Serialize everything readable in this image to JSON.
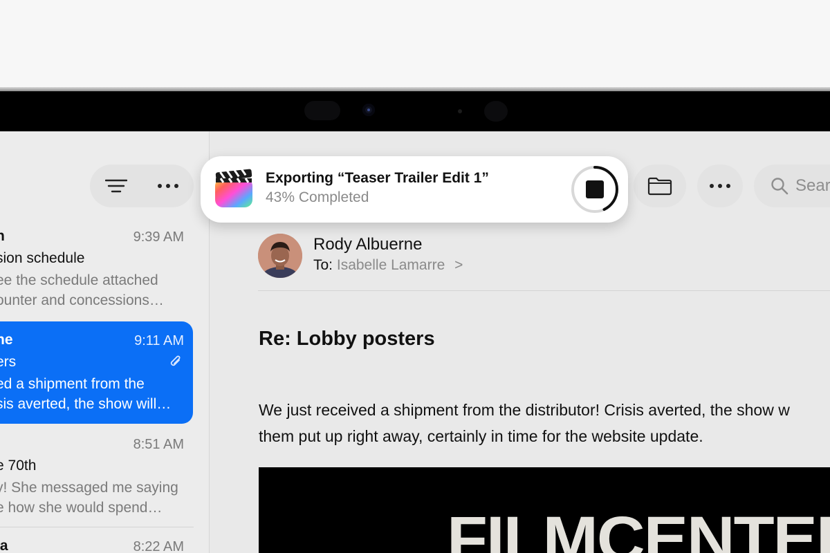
{
  "sidebar": {
    "toolbar": {
      "filter_icon": "filter-lines-icon",
      "more_icon": "ellipsis-icon"
    },
    "messages": [
      {
        "sender": "n",
        "time": "9:39 AM",
        "subject": "sion schedule",
        "preview_line_1": "ee the schedule attached",
        "preview_line_2": "ounter and concessions…",
        "selected": false
      },
      {
        "sender": "ne",
        "time": "9:11 AM",
        "subject": "ers",
        "preview_line_1": "ed a shipment from the",
        "preview_line_2": "sis averted, the show will…",
        "selected": true,
        "attachment_icon": "paperclip-icon"
      },
      {
        "sender": "",
        "time": "8:51 AM",
        "subject": "e 70th",
        "preview_line_1": "y! She messaged me saying",
        "preview_line_2": "e how she would spend…",
        "selected": false
      },
      {
        "sender": "ia",
        "time": "8:22 AM",
        "subject": "",
        "preview_line_1": "",
        "preview_line_2": "",
        "selected": false
      }
    ]
  },
  "toolbar": {
    "folder_icon": "folder-icon",
    "more_icon": "ellipsis-icon",
    "search_icon": "magnifier-icon",
    "search_placeholder": "Sear"
  },
  "email": {
    "sender_name": "Rody Albuerne",
    "to_label": "To:",
    "recipient": "Isabelle Lamarre",
    "recipient_chevron": ">",
    "subject": "Re: Lobby posters",
    "body_line_1": "We just received a shipment from the distributor! Crisis averted, the show w",
    "body_line_2": "them put up right away, certainly in time for the website update.",
    "poster_logo_text": "FILMCENTER"
  },
  "export_notification": {
    "app_icon": "final-cut-pro-icon",
    "title": "Exporting “Teaser Trailer Edit 1”",
    "status": "43% Completed",
    "progress": 0.43,
    "stop_icon": "stop-square-icon"
  },
  "colors": {
    "selection_blue": "#0b6ff6",
    "background": "#e9e9e9",
    "secondary_text": "#7a7a7a"
  }
}
